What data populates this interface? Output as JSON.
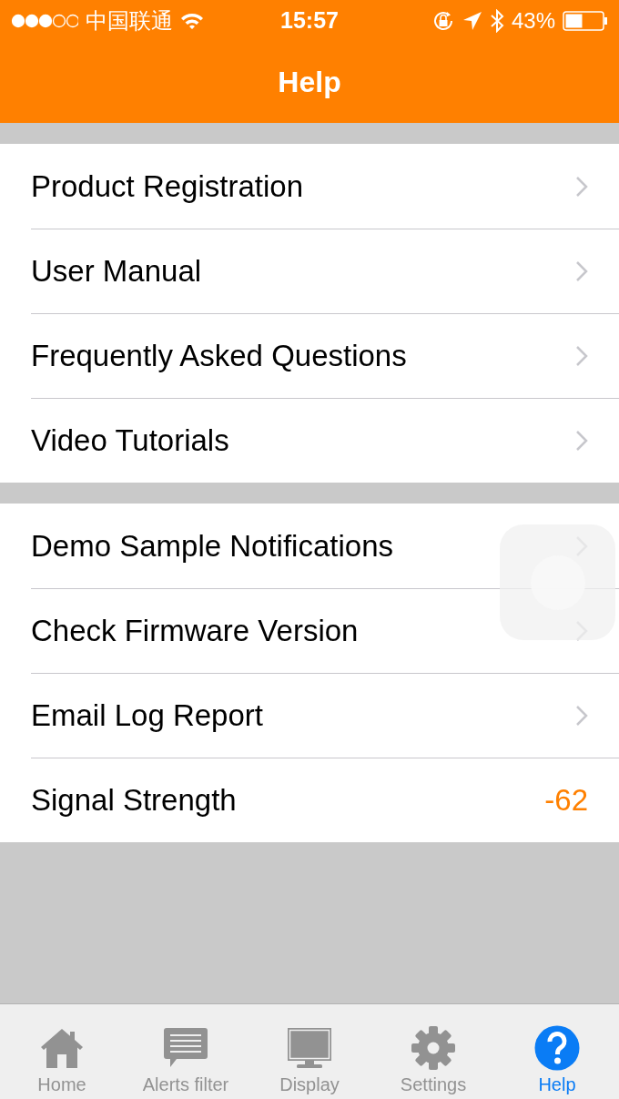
{
  "status_bar": {
    "carrier": "中国联通",
    "time": "15:57",
    "battery": "43%"
  },
  "nav_bar": {
    "title": "Help"
  },
  "groups": [
    {
      "rows": [
        {
          "kind": "link",
          "label": "Product Registration"
        },
        {
          "kind": "link",
          "label": "User Manual"
        },
        {
          "kind": "link",
          "label": "Frequently Asked Questions"
        },
        {
          "kind": "link",
          "label": "Video Tutorials"
        }
      ]
    },
    {
      "rows": [
        {
          "kind": "link",
          "label": "Demo Sample Notifications"
        },
        {
          "kind": "link",
          "label": "Check Firmware Version"
        },
        {
          "kind": "link",
          "label": "Email Log Report"
        },
        {
          "kind": "value",
          "label": "Signal Strength",
          "value": "-62"
        }
      ]
    }
  ],
  "tab_bar": [
    {
      "kind": "home",
      "label": "Home",
      "selected": false
    },
    {
      "kind": "alerts",
      "label": "Alerts filter",
      "selected": false
    },
    {
      "kind": "display",
      "label": "Display",
      "selected": false
    },
    {
      "kind": "settings",
      "label": "Settings",
      "selected": false
    },
    {
      "kind": "help",
      "label": "Help",
      "selected": true
    }
  ]
}
